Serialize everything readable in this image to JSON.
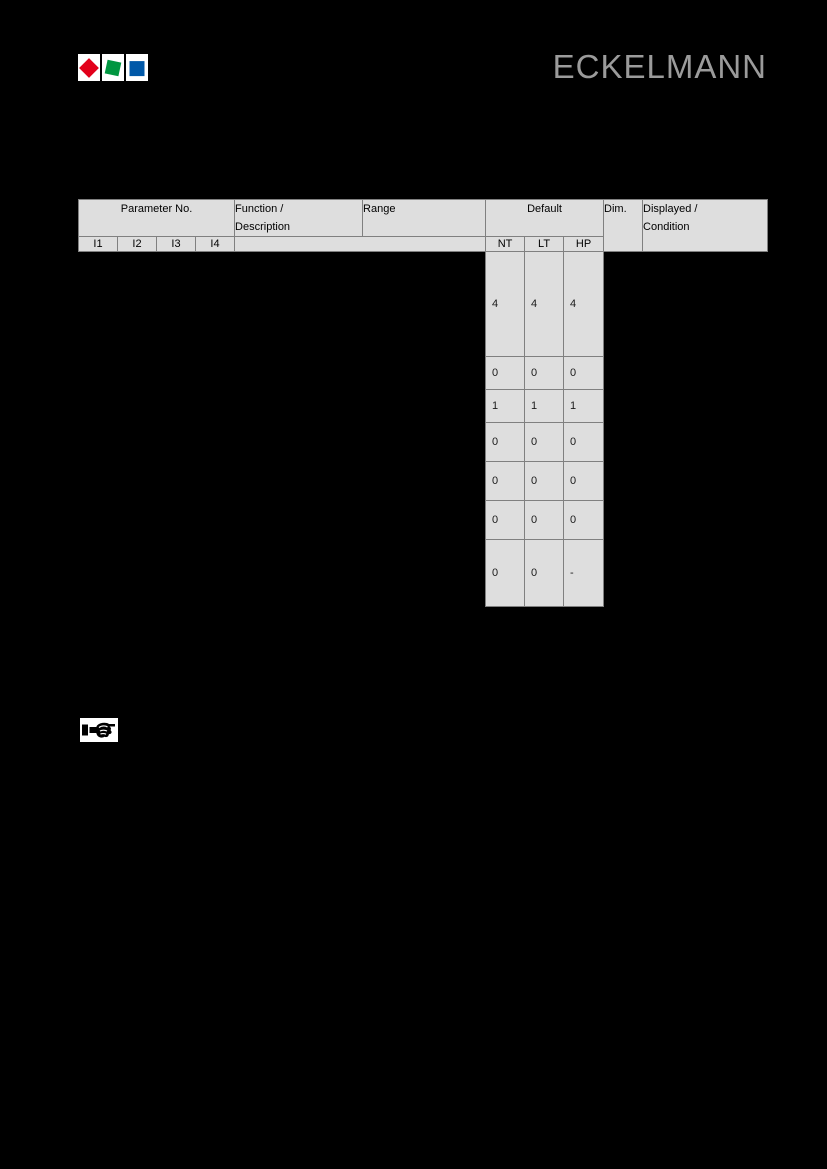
{
  "document": {
    "background_color": "#000000",
    "brand": {
      "wordmark": "ECKELMANN",
      "wordmark_color": "#9b9b9b",
      "logo_tiles": [
        {
          "name": "red-diamond",
          "color": "#e2001a"
        },
        {
          "name": "green-square",
          "color": "#009640"
        },
        {
          "name": "blue-square",
          "color": "#0058a8"
        }
      ]
    }
  },
  "table": {
    "header": {
      "parameter_no": "Parameter No.",
      "function_description": "Function /\nDescription",
      "function_description_line1": "Function /",
      "function_description_line2": "Description",
      "range": "Range",
      "default": "Default",
      "dim": "Dim.",
      "displayed_condition_line1": "Displayed /",
      "displayed_condition_line2": "Condition",
      "sub": {
        "i1": "I1",
        "i2": "I2",
        "i3": "I3",
        "i4": "I4",
        "nt": "NT",
        "lt": "LT",
        "hp": "HP"
      }
    },
    "columns": [
      "I1",
      "I2",
      "I3",
      "I4",
      "Function / Description",
      "Range",
      "NT",
      "LT",
      "HP",
      "Dim.",
      "Displayed / Condition"
    ],
    "rows": [
      {
        "i1": "",
        "i2": "",
        "i3": "",
        "i4": "",
        "function": "",
        "range": "",
        "nt": "4",
        "lt": "4",
        "hp": "4",
        "dim": "",
        "condition": "",
        "height": "tall"
      },
      {
        "i1": "",
        "i2": "",
        "i3": "",
        "i4": "",
        "function": "",
        "range": "",
        "nt": "0",
        "lt": "0",
        "hp": "0",
        "dim": "",
        "condition": "",
        "height": "short"
      },
      {
        "i1": "",
        "i2": "",
        "i3": "",
        "i4": "",
        "function": "",
        "range": "",
        "nt": "1",
        "lt": "1",
        "hp": "1",
        "dim": "",
        "condition": "",
        "height": "short"
      },
      {
        "i1": "",
        "i2": "",
        "i3": "",
        "i4": "",
        "function": "",
        "range": "",
        "nt": "0",
        "lt": "0",
        "hp": "0",
        "dim": "",
        "condition": "",
        "height": "mid"
      },
      {
        "i1": "",
        "i2": "",
        "i3": "",
        "i4": "",
        "function": "",
        "range": "",
        "nt": "0",
        "lt": "0",
        "hp": "0",
        "dim": "",
        "condition": "",
        "height": "mid"
      },
      {
        "i1": "",
        "i2": "",
        "i3": "",
        "i4": "",
        "function": "",
        "range": "",
        "nt": "0",
        "lt": "0",
        "hp": "0",
        "dim": "",
        "condition": "",
        "height": "mid"
      },
      {
        "i1": "",
        "i2": "",
        "i3": "",
        "i4": "",
        "function": "",
        "range": "",
        "nt": "0",
        "lt": "0",
        "hp": "-",
        "dim": "",
        "condition": "",
        "height": "last"
      }
    ],
    "cell_background": "#dedede",
    "border_color": "#808080"
  },
  "note": {
    "icon": "pointing-hand-icon"
  }
}
